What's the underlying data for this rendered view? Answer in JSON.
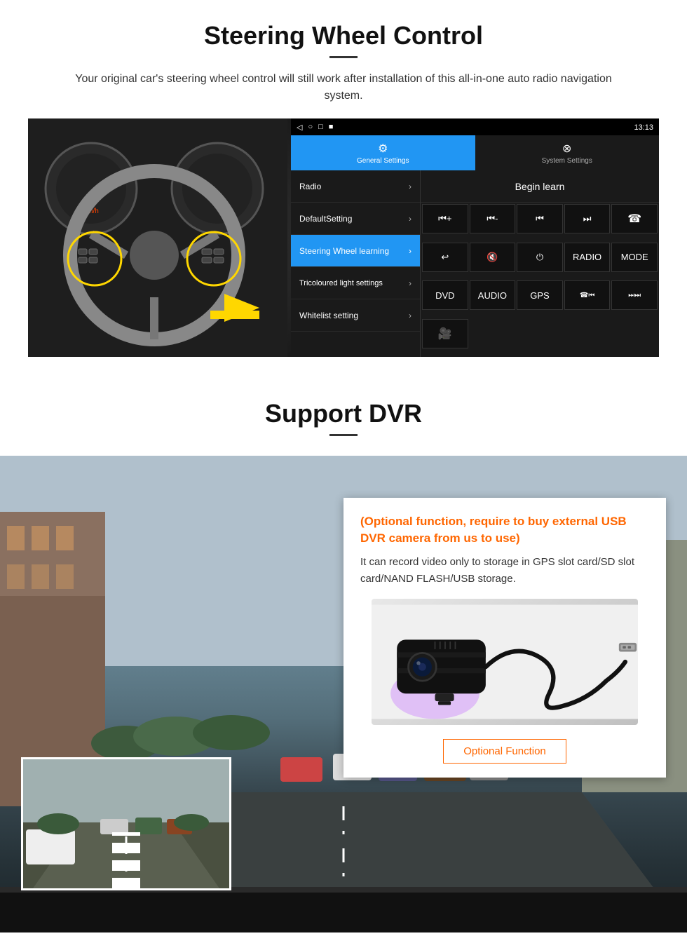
{
  "section1": {
    "title": "Steering Wheel Control",
    "description": "Your original car's steering wheel control will still work after installation of this all-in-one auto radio navigation system.",
    "android": {
      "statusbar": {
        "time": "13:13",
        "signal_icon": "▾",
        "wifi_icon": "▾"
      },
      "nav_buttons": [
        "◁",
        "○",
        "□",
        "■"
      ],
      "tabs": [
        {
          "icon": "⚙",
          "label": "General Settings",
          "active": true
        },
        {
          "icon": "⊗",
          "label": "System Settings",
          "active": false
        }
      ],
      "menu_items": [
        {
          "label": "Radio",
          "highlighted": false
        },
        {
          "label": "DefaultSetting",
          "highlighted": false
        },
        {
          "label": "Steering Wheel learning",
          "highlighted": true
        },
        {
          "label": "Tricoloured light settings",
          "highlighted": false
        },
        {
          "label": "Whitelist setting",
          "highlighted": false
        }
      ],
      "begin_learn": "Begin learn",
      "control_buttons": [
        "◀◀+",
        "◀◀-",
        "◀◀",
        "▶▶",
        "☎",
        "↩",
        "🔇",
        "⏻",
        "RADIO",
        "MODE",
        "DVD",
        "AUDIO",
        "GPS",
        "☎◀▶",
        "⏭⏭"
      ]
    }
  },
  "section2": {
    "title": "Support DVR",
    "optional_text": "(Optional function, require to buy external USB DVR camera from us to use)",
    "description": "It can record video only to storage in GPS slot card/SD slot card/NAND FLASH/USB storage.",
    "optional_function_label": "Optional Function"
  }
}
